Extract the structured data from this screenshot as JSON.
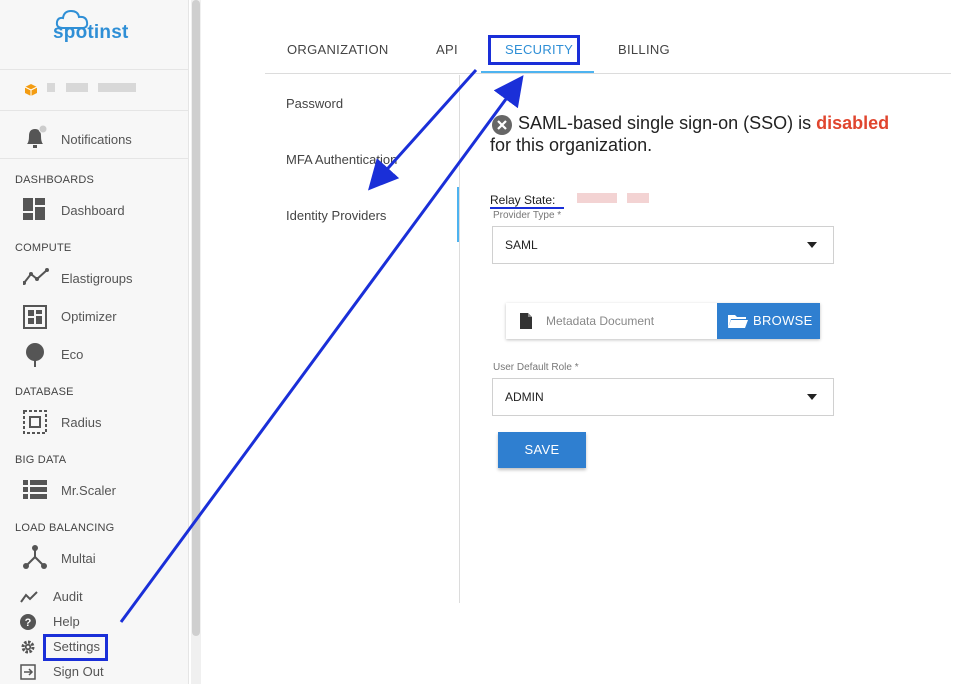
{
  "brand": {
    "name": "spotinst",
    "color": "#2f8fd6"
  },
  "sidebar": {
    "notifications": "Notifications",
    "sections": [
      {
        "title": "DASHBOARDS",
        "items": [
          {
            "label": "Dashboard",
            "icon": "dashboard-icon"
          }
        ]
      },
      {
        "title": "COMPUTE",
        "items": [
          {
            "label": "Elastigroups",
            "icon": "elastigroups-icon"
          },
          {
            "label": "Optimizer",
            "icon": "optimizer-icon"
          },
          {
            "label": "Eco",
            "icon": "eco-icon"
          }
        ]
      },
      {
        "title": "DATABASE",
        "items": [
          {
            "label": "Radius",
            "icon": "radius-icon"
          }
        ]
      },
      {
        "title": "BIG DATA",
        "items": [
          {
            "label": "Mr.Scaler",
            "icon": "mrscaler-icon"
          }
        ]
      },
      {
        "title": "LOAD BALANCING",
        "items": [
          {
            "label": "Multai",
            "icon": "multai-icon"
          }
        ]
      }
    ],
    "bottom": [
      {
        "label": "Audit",
        "icon": "audit-icon"
      },
      {
        "label": "Help",
        "icon": "help-icon"
      },
      {
        "label": "Settings",
        "icon": "gear-icon"
      },
      {
        "label": "Sign Out",
        "icon": "sign-out-icon"
      }
    ]
  },
  "tabs": [
    {
      "label": "ORGANIZATION"
    },
    {
      "label": "API"
    },
    {
      "label": "SECURITY",
      "active": true
    },
    {
      "label": "BILLING"
    }
  ],
  "submenu": [
    {
      "label": "Password"
    },
    {
      "label": "MFA Authentication"
    },
    {
      "label": "Identity Providers",
      "active": true
    }
  ],
  "sso": {
    "prefix": "SAML-based single sign-on (SSO) is ",
    "status": "disabled",
    "suffix": "for this organization.",
    "status_color": "#e0452e"
  },
  "form": {
    "relay_state_label": "Relay State:",
    "provider_type_label": "Provider Type *",
    "provider_type_value": "SAML",
    "metadata_placeholder": "Metadata Document",
    "browse_label": "BROWSE",
    "user_role_label": "User Default Role *",
    "user_role_value": "ADMIN",
    "save_label": "SAVE"
  },
  "colors": {
    "accent": "#2f7fd0",
    "tab_active": "#2f8fd6",
    "annotation": "#1a2fd8"
  }
}
